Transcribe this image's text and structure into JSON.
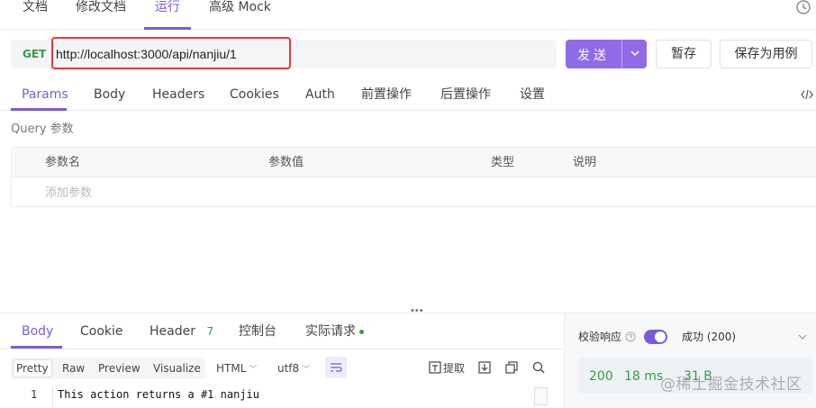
{
  "top_tabs": [
    "文档",
    "修改文档",
    "运行",
    "高级 Mock"
  ],
  "request": {
    "method": "GET",
    "url": "http://localhost:3000/api/nanjiu/1",
    "send_label": "发送",
    "save_temp_label": "暂存",
    "save_case_label": "保存为用例"
  },
  "request_tabs": [
    "Params",
    "Body",
    "Headers",
    "Cookies",
    "Auth",
    "前置操作",
    "后置操作",
    "设置"
  ],
  "query": {
    "section_label": "Query 参数",
    "columns": [
      "参数名",
      "参数值",
      "类型",
      "说明"
    ],
    "add_placeholder": "添加参数"
  },
  "response": {
    "tabs": [
      {
        "label": "Body"
      },
      {
        "label": "Cookie"
      },
      {
        "label": "Header",
        "count": "7"
      },
      {
        "label": "控制台"
      },
      {
        "label": "实际请求"
      }
    ],
    "formats": [
      "Pretty",
      "Raw",
      "Preview",
      "Visualize"
    ],
    "language": "HTML",
    "encoding": "utf8",
    "extract_label": "提取",
    "lines": [
      {
        "no": "1",
        "text": "This action returns a #1 nanjiu"
      }
    ]
  },
  "validation": {
    "label": "校验响应",
    "enabled": true,
    "status_option": "成功 (200)"
  },
  "metrics": {
    "status": "200",
    "time": "18 ms",
    "size": "31 B"
  },
  "watermark": "@稀土掘金技术社区",
  "colors": {
    "accent": "#7b5cd6",
    "send_button": "#8f6be8",
    "success": "#2ea043",
    "highlight_border": "#e53935"
  }
}
